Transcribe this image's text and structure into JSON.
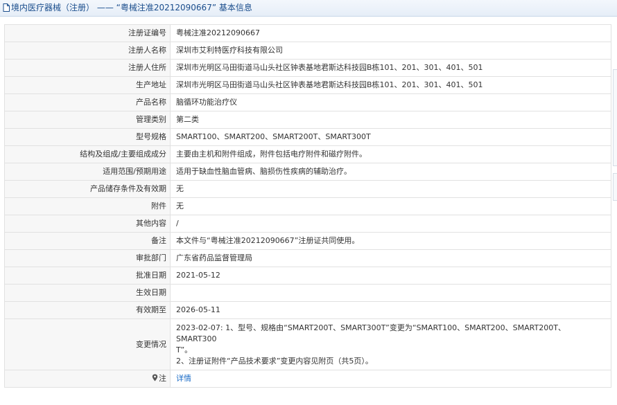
{
  "header": {
    "title": "境内医疗器械（注册） —— “粤械注准20212090667” 基本信息"
  },
  "rows": [
    {
      "label": "注册证编号",
      "value": "粤械注准20212090667"
    },
    {
      "label": "注册人名称",
      "value": "深圳市艾利特医疗科技有限公司"
    },
    {
      "label": "注册人住所",
      "value": "深圳市光明区马田街道马山头社区钟表基地君斯达科技园B栋101、201、301、401、501"
    },
    {
      "label": "生产地址",
      "value": "深圳市光明区马田街道马山头社区钟表基地君斯达科技园B栋101、201、301、401、501"
    },
    {
      "label": "产品名称",
      "value": "脑循环功能治疗仪"
    },
    {
      "label": "管理类别",
      "value": "第二类"
    },
    {
      "label": "型号规格",
      "value": "SMART100、SMART200、SMART200T、SMART300T"
    },
    {
      "label": "结构及组成/主要组成成分",
      "value": "主要由主机和附件组成，附件包括电疗附件和磁疗附件。"
    },
    {
      "label": "适用范围/预期用途",
      "value": "适用于缺血性脑血管病、脑损伤性疾病的辅助治疗。"
    },
    {
      "label": "产品储存条件及有效期",
      "value": "无"
    },
    {
      "label": "附件",
      "value": "无"
    },
    {
      "label": "其他内容",
      "value": "/"
    },
    {
      "label": "备注",
      "value": "本文件与“粤械注准20212090667”注册证共同使用。"
    },
    {
      "label": "审批部门",
      "value": "广东省药品监督管理局"
    },
    {
      "label": "批准日期",
      "value": "2021-05-12"
    },
    {
      "label": "生效日期",
      "value": ""
    },
    {
      "label": "有效期至",
      "value": "2026-05-11"
    }
  ],
  "change": {
    "label": "变更情况",
    "line1": "2023-02-07: 1、型号、规格由“SMART200T、SMART300T”变更为“SMART100、SMART200、SMART200T、SMART300",
    "line2": "T”。",
    "line3": "2、注册证附件“产品技术要求”变更内容见附页（共5页）。"
  },
  "note": {
    "label": "注",
    "link_text": "详情",
    "icon": "pin-icon"
  },
  "colors": {
    "title": "#1a4d8c",
    "link": "#1a6bc6",
    "label_bg": "#f7f7f7",
    "border": "#e1e1e1"
  }
}
